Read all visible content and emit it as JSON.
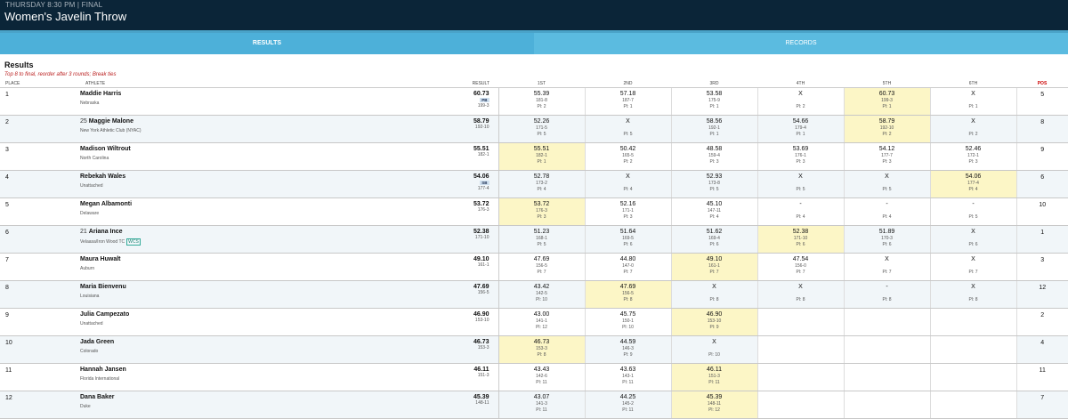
{
  "header": {
    "subtitle": "THURSDAY 8:30 PM | FINAL",
    "title": "Women's Javelin Throw"
  },
  "tabs": [
    {
      "label": "RESULTS",
      "active": true
    },
    {
      "label": "RECORDS",
      "active": false
    }
  ],
  "results": {
    "title": "Results",
    "note": "Top 8 to final, reorder after 3 rounds; Break ties",
    "headers": {
      "place": "PLACE",
      "athlete": "ATHLETE",
      "result": "RESULT",
      "rounds": [
        "1ST",
        "2ND",
        "3RD",
        "4TH",
        "5TH",
        "6TH"
      ],
      "pos": "POS"
    },
    "rows": [
      {
        "place": "1",
        "bib": "",
        "name": "Maddie Harris",
        "team": "Nebraska",
        "team_badge": "",
        "mark": "60.73",
        "mark_badge": "PB",
        "imperial": "199-3",
        "pos": "5",
        "attempts": [
          {
            "mark": "55.39",
            "imp": "181-8",
            "pl": "Pl: 2",
            "best": false
          },
          {
            "mark": "57.18",
            "imp": "187-7",
            "pl": "Pl: 1",
            "best": false
          },
          {
            "mark": "53.58",
            "imp": "175-9",
            "pl": "Pl: 1",
            "best": false
          },
          {
            "mark": "X",
            "imp": "",
            "pl": "Pl: 2",
            "best": false
          },
          {
            "mark": "60.73",
            "imp": "199-3",
            "pl": "Pl: 1",
            "best": true
          },
          {
            "mark": "X",
            "imp": "",
            "pl": "Pl: 1",
            "best": false
          }
        ]
      },
      {
        "place": "2",
        "bib": "25",
        "name": "Maggie Malone",
        "team": "New York Athletic Club (NYAC)",
        "team_badge": "",
        "mark": "58.79",
        "mark_badge": "",
        "imperial": "192-10",
        "pos": "8",
        "attempts": [
          {
            "mark": "52.26",
            "imp": "171-5",
            "pl": "Pl: 5",
            "best": false
          },
          {
            "mark": "X",
            "imp": "",
            "pl": "Pl: 5",
            "best": false
          },
          {
            "mark": "58.56",
            "imp": "192-1",
            "pl": "Pl: 1",
            "best": false
          },
          {
            "mark": "54.66",
            "imp": "179-4",
            "pl": "Pl: 1",
            "best": false
          },
          {
            "mark": "58.79",
            "imp": "192-10",
            "pl": "Pl: 2",
            "best": true
          },
          {
            "mark": "X",
            "imp": "",
            "pl": "Pl: 2",
            "best": false
          }
        ]
      },
      {
        "place": "3",
        "bib": "",
        "name": "Madison Wiltrout",
        "team": "North Carolina",
        "team_badge": "",
        "mark": "55.51",
        "mark_badge": "",
        "imperial": "182-1",
        "pos": "9",
        "attempts": [
          {
            "mark": "55.51",
            "imp": "182-1",
            "pl": "Pl: 1",
            "best": true
          },
          {
            "mark": "50.42",
            "imp": "165-5",
            "pl": "Pl: 2",
            "best": false
          },
          {
            "mark": "48.58",
            "imp": "159-4",
            "pl": "Pl: 3",
            "best": false
          },
          {
            "mark": "53.69",
            "imp": "176-1",
            "pl": "Pl: 3",
            "best": false
          },
          {
            "mark": "54.12",
            "imp": "177-7",
            "pl": "Pl: 3",
            "best": false
          },
          {
            "mark": "52.46",
            "imp": "172-1",
            "pl": "Pl: 3",
            "best": false
          }
        ]
      },
      {
        "place": "4",
        "bib": "",
        "name": "Rebekah Wales",
        "team": "Unattached",
        "team_badge": "",
        "mark": "54.06",
        "mark_badge": "SB",
        "imperial": "177-4",
        "pos": "6",
        "attempts": [
          {
            "mark": "52.78",
            "imp": "173-2",
            "pl": "Pl: 4",
            "best": false
          },
          {
            "mark": "X",
            "imp": "",
            "pl": "Pl: 4",
            "best": false
          },
          {
            "mark": "52.93",
            "imp": "173-8",
            "pl": "Pl: 5",
            "best": false
          },
          {
            "mark": "X",
            "imp": "",
            "pl": "Pl: 5",
            "best": false
          },
          {
            "mark": "X",
            "imp": "",
            "pl": "Pl: 5",
            "best": false
          },
          {
            "mark": "54.06",
            "imp": "177-4",
            "pl": "Pl: 4",
            "best": true
          }
        ]
      },
      {
        "place": "5",
        "bib": "",
        "name": "Megan Albamonti",
        "team": "Delaware",
        "team_badge": "",
        "mark": "53.72",
        "mark_badge": "",
        "imperial": "176-3",
        "pos": "10",
        "attempts": [
          {
            "mark": "53.72",
            "imp": "176-3",
            "pl": "Pl: 3",
            "best": true
          },
          {
            "mark": "52.16",
            "imp": "171-1",
            "pl": "Pl: 3",
            "best": false
          },
          {
            "mark": "45.10",
            "imp": "147-11",
            "pl": "Pl: 4",
            "best": false
          },
          {
            "mark": "-",
            "imp": "",
            "pl": "Pl: 4",
            "best": false
          },
          {
            "mark": "-",
            "imp": "",
            "pl": "Pl: 4",
            "best": false
          },
          {
            "mark": "-",
            "imp": "",
            "pl": "Pl: 5",
            "best": false
          }
        ]
      },
      {
        "place": "6",
        "bib": "21",
        "name": "Ariana Ince",
        "team": "Velaasa/Iron Wood TC",
        "team_badge": "WCS",
        "mark": "52.38",
        "mark_badge": "",
        "imperial": "171-10",
        "pos": "1",
        "attempts": [
          {
            "mark": "51.23",
            "imp": "168-1",
            "pl": "Pl: 5",
            "best": false
          },
          {
            "mark": "51.64",
            "imp": "169-5",
            "pl": "Pl: 6",
            "best": false
          },
          {
            "mark": "51.62",
            "imp": "169-4",
            "pl": "Pl: 6",
            "best": false
          },
          {
            "mark": "52.38",
            "imp": "171-10",
            "pl": "Pl: 6",
            "best": true
          },
          {
            "mark": "51.89",
            "imp": "170-3",
            "pl": "Pl: 6",
            "best": false
          },
          {
            "mark": "X",
            "imp": "",
            "pl": "Pl: 6",
            "best": false
          }
        ]
      },
      {
        "place": "7",
        "bib": "",
        "name": "Maura Huwalt",
        "team": "Auburn",
        "team_badge": "",
        "mark": "49.10",
        "mark_badge": "",
        "imperial": "161-1",
        "pos": "3",
        "attempts": [
          {
            "mark": "47.69",
            "imp": "156-5",
            "pl": "Pl: 7",
            "best": false
          },
          {
            "mark": "44.80",
            "imp": "147-0",
            "pl": "Pl: 7",
            "best": false
          },
          {
            "mark": "49.10",
            "imp": "161-1",
            "pl": "Pl: 7",
            "best": true
          },
          {
            "mark": "47.54",
            "imp": "156-0",
            "pl": "Pl: 7",
            "best": false
          },
          {
            "mark": "X",
            "imp": "",
            "pl": "Pl: 7",
            "best": false
          },
          {
            "mark": "X",
            "imp": "",
            "pl": "Pl: 7",
            "best": false
          }
        ]
      },
      {
        "place": "8",
        "bib": "",
        "name": "Maria Bienvenu",
        "team": "Louisiana",
        "team_badge": "",
        "mark": "47.69",
        "mark_badge": "",
        "imperial": "156-5",
        "pos": "12",
        "attempts": [
          {
            "mark": "43.42",
            "imp": "142-5",
            "pl": "Pl: 10",
            "best": false
          },
          {
            "mark": "47.69",
            "imp": "156-5",
            "pl": "Pl: 8",
            "best": true
          },
          {
            "mark": "X",
            "imp": "",
            "pl": "Pl: 8",
            "best": false
          },
          {
            "mark": "X",
            "imp": "",
            "pl": "Pl: 8",
            "best": false
          },
          {
            "mark": "-",
            "imp": "",
            "pl": "Pl: 8",
            "best": false
          },
          {
            "mark": "X",
            "imp": "",
            "pl": "Pl: 8",
            "best": false
          }
        ]
      },
      {
        "place": "9",
        "bib": "",
        "name": "Julia Campezato",
        "team": "Unattached",
        "team_badge": "",
        "mark": "46.90",
        "mark_badge": "",
        "imperial": "153-10",
        "pos": "2",
        "attempts": [
          {
            "mark": "43.00",
            "imp": "141-1",
            "pl": "Pl: 12",
            "best": false
          },
          {
            "mark": "45.75",
            "imp": "150-1",
            "pl": "Pl: 10",
            "best": false
          },
          {
            "mark": "46.90",
            "imp": "153-10",
            "pl": "Pl: 9",
            "best": true
          },
          null,
          null,
          null
        ]
      },
      {
        "place": "10",
        "bib": "",
        "name": "Jada Green",
        "team": "Colorado",
        "team_badge": "",
        "mark": "46.73",
        "mark_badge": "",
        "imperial": "153-3",
        "pos": "4",
        "attempts": [
          {
            "mark": "46.73",
            "imp": "153-3",
            "pl": "Pl: 8",
            "best": true
          },
          {
            "mark": "44.59",
            "imp": "146-3",
            "pl": "Pl: 9",
            "best": false
          },
          {
            "mark": "X",
            "imp": "",
            "pl": "Pl: 10",
            "best": false
          },
          null,
          null,
          null
        ]
      },
      {
        "place": "11",
        "bib": "",
        "name": "Hannah Jansen",
        "team": "Florida International",
        "team_badge": "",
        "mark": "46.11",
        "mark_badge": "",
        "imperial": "151-3",
        "pos": "11",
        "attempts": [
          {
            "mark": "43.43",
            "imp": "142-6",
            "pl": "Pl: 11",
            "best": false
          },
          {
            "mark": "43.63",
            "imp": "143-1",
            "pl": "Pl: 11",
            "best": false
          },
          {
            "mark": "46.11",
            "imp": "151-3",
            "pl": "Pl: 11",
            "best": true
          },
          null,
          null,
          null
        ]
      },
      {
        "place": "12",
        "bib": "",
        "name": "Dana Baker",
        "team": "Duke",
        "team_badge": "",
        "mark": "45.39",
        "mark_badge": "",
        "imperial": "148-11",
        "pos": "7",
        "attempts": [
          {
            "mark": "43.07",
            "imp": "141-3",
            "pl": "Pl: 11",
            "best": false
          },
          {
            "mark": "44.25",
            "imp": "145-2",
            "pl": "Pl: 11",
            "best": false
          },
          {
            "mark": "45.39",
            "imp": "148-11",
            "pl": "Pl: 12",
            "best": true
          },
          null,
          null,
          null
        ]
      }
    ]
  }
}
